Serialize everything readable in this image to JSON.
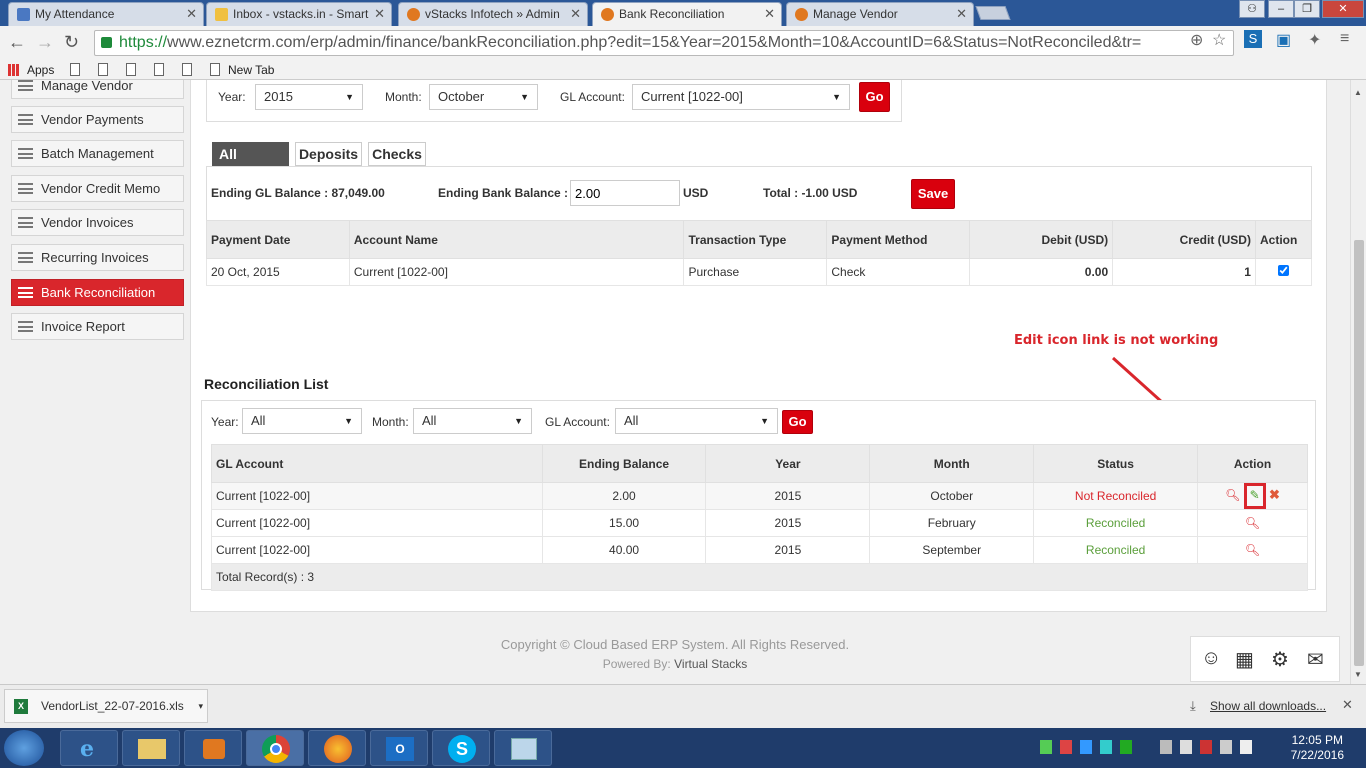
{
  "browser": {
    "tabs": [
      {
        "label": "My Attendance",
        "active": false
      },
      {
        "label": "Inbox - vstacks.in - Smart",
        "active": false
      },
      {
        "label": "vStacks Infotech » Admin",
        "active": false
      },
      {
        "label": "Bank Reconciliation",
        "active": true
      },
      {
        "label": "Manage Vendor",
        "active": false
      }
    ],
    "url_https": "https://",
    "url_rest": "www.eznetcrm.com/erp/admin/finance/bankReconciliation.php?edit=15&Year=2015&Month=10&AccountID=6&Status=NotReconciled&tr=",
    "bookmarks": {
      "apps": "Apps",
      "new_tab": "New Tab"
    }
  },
  "sidebar": {
    "items": [
      {
        "label": "Manage Vendor",
        "active": false
      },
      {
        "label": "Vendor Payments",
        "active": false
      },
      {
        "label": "Batch Management",
        "active": false
      },
      {
        "label": "Vendor Credit Memo",
        "active": false
      },
      {
        "label": "Vendor Invoices",
        "active": false
      },
      {
        "label": "Recurring Invoices",
        "active": false
      },
      {
        "label": "Bank Reconciliation",
        "active": true
      },
      {
        "label": "Invoice Report",
        "active": false
      }
    ]
  },
  "filter": {
    "year_label": "Year:",
    "year_value": "2015",
    "month_label": "Month:",
    "month_value": "October",
    "gl_label": "GL Account:",
    "gl_value": "Current [1022-00]",
    "go": "Go"
  },
  "type_tabs": {
    "all": "All",
    "deposits": "Deposits",
    "checks": "Checks"
  },
  "balances": {
    "ending_gl": "Ending GL Balance : 87,049.00",
    "ending_bank_label": "Ending Bank Balance :",
    "ending_bank_value": "2.00",
    "currency": "USD",
    "total": "Total : -1.00 USD",
    "save": "Save"
  },
  "transactions": {
    "headers": [
      "Payment Date",
      "Account Name",
      "Transaction Type",
      "Payment Method",
      "Debit (USD)",
      "Credit (USD)",
      "Action"
    ],
    "rows": [
      {
        "date": "20 Oct, 2015",
        "account": "Current [1022-00]",
        "type": "Purchase",
        "method": "Check",
        "debit": "0.00",
        "credit": "1",
        "checked": true
      }
    ]
  },
  "annotation": "Edit icon link is not working",
  "reconciliation": {
    "title": "Reconciliation List",
    "year_label": "Year:",
    "year_value": "All",
    "month_label": "Month:",
    "month_value": "All",
    "gl_label": "GL Account:",
    "gl_value": "All",
    "go": "Go",
    "headers": [
      "GL Account",
      "Ending Balance",
      "Year",
      "Month",
      "Status",
      "Action"
    ],
    "rows": [
      {
        "account": "Current [1022-00]",
        "balance": "2.00",
        "year": "2015",
        "month": "October",
        "status": "Not Reconciled",
        "reconciled": false
      },
      {
        "account": "Current [1022-00]",
        "balance": "15.00",
        "year": "2015",
        "month": "February",
        "status": "Reconciled",
        "reconciled": true
      },
      {
        "account": "Current [1022-00]",
        "balance": "40.00",
        "year": "2015",
        "month": "September",
        "status": "Reconciled",
        "reconciled": true
      }
    ],
    "total": "Total Record(s) :  3"
  },
  "footer": {
    "copyright": "Copyright © Cloud Based ERP System. All Rights Reserved.",
    "powered_label": "Powered By:",
    "powered_by": "Virtual Stacks"
  },
  "downloads": {
    "file": "VendorList_22-07-2016.xls",
    "show_all": "Show all downloads..."
  },
  "clock": {
    "time": "12:05 PM",
    "date": "7/22/2016"
  }
}
